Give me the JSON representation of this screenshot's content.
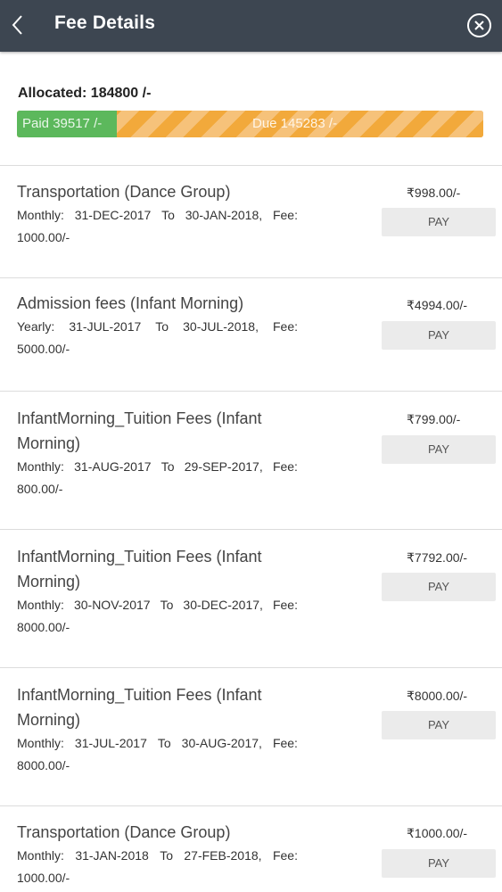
{
  "header": {
    "title": "Fee Details",
    "back_icon": "chevron-left-icon",
    "close_icon": "close-circle-icon"
  },
  "summary": {
    "allocated": "Allocated: 184800 /-",
    "paid_label": "Paid 39517 /-",
    "due_label": "Due 145283 /-",
    "paid_fraction": 0.2138,
    "colors": {
      "paid": "#5cb85c",
      "due": "#f2a93b"
    }
  },
  "fees": [
    {
      "title": "Transportation (Dance Group)",
      "period": "Monthly:",
      "start": "31-DEC-2017",
      "to": "To",
      "end": "30-JAN-2018,",
      "fee_label": "Fee:",
      "fee": "1000.00/-",
      "amount": "₹998.00/-",
      "pay": "PAY"
    },
    {
      "title": "Admission fees (Infant Morning)",
      "period": "Yearly:",
      "start": "31-JUL-2017",
      "to": "To",
      "end": "30-JUL-2018,",
      "fee_label": "Fee:",
      "fee": "5000.00/-",
      "amount": "₹4994.00/-",
      "pay": "PAY"
    },
    {
      "title": "InfantMorning_Tuition Fees (Infant Morning)",
      "period": "Monthly:",
      "start": "31-AUG-2017",
      "to": "To",
      "end": "29-SEP-2017,",
      "fee_label": "Fee:",
      "fee": "800.00/-",
      "amount": "₹799.00/-",
      "pay": "PAY"
    },
    {
      "title": "InfantMorning_Tuition Fees (Infant Morning)",
      "period": "Monthly:",
      "start": "30-NOV-2017",
      "to": "To",
      "end": "30-DEC-2017,",
      "fee_label": "Fee:",
      "fee": "8000.00/-",
      "amount": "₹7792.00/-",
      "pay": "PAY"
    },
    {
      "title": "InfantMorning_Tuition Fees (Infant Morning)",
      "period": "Monthly:",
      "start": "31-JUL-2017",
      "to": "To",
      "end": "30-AUG-2017,",
      "fee_label": "Fee:",
      "fee": "8000.00/-",
      "amount": "₹8000.00/-",
      "pay": "PAY"
    },
    {
      "title": "Transportation (Dance Group)",
      "period": "Monthly:",
      "start": "31-JAN-2018",
      "to": "To",
      "end": "27-FEB-2018,",
      "fee_label": "Fee:",
      "fee": "1000.00/-",
      "amount": "₹1000.00/-",
      "pay": "PAY"
    }
  ]
}
